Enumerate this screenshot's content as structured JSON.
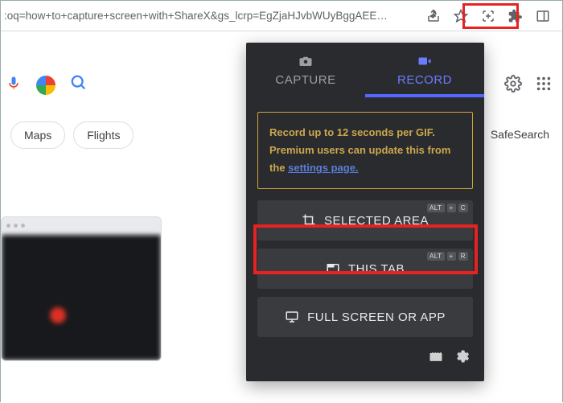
{
  "browser": {
    "url_fragment": ":oq=how+to+capture+screen+with+ShareX&gs_lcrp=EgZjaHJvbWUyBggAEE…"
  },
  "google": {
    "chips": [
      "Maps",
      "Flights"
    ],
    "safesearch_label": "SafeSearch"
  },
  "panel": {
    "tabs": {
      "capture": "CAPTURE",
      "record": "RECORD"
    },
    "info_text_1": "Record up to 12 seconds per GIF. Premium users can update this from the",
    "info_link": "settings page.",
    "options": {
      "selected_area": {
        "label": "SELECTED AREA",
        "kbd": [
          "ALT",
          "+",
          "C"
        ]
      },
      "this_tab": {
        "label": "THIS TAB",
        "kbd": [
          "ALT",
          "+",
          "R"
        ]
      },
      "full_screen": {
        "label": "FULL SCREEN OR APP"
      }
    }
  }
}
